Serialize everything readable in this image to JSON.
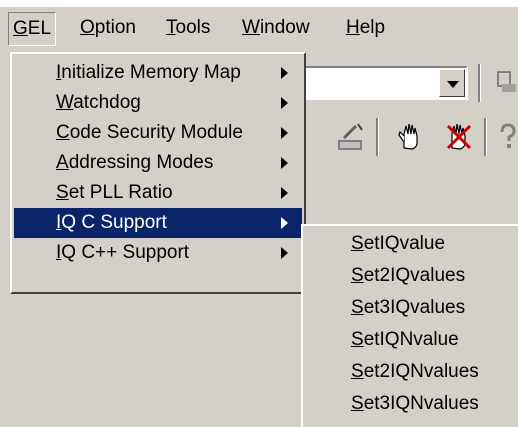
{
  "menubar": {
    "items": [
      {
        "label": "GEL",
        "accel": "G",
        "rest": "EL"
      },
      {
        "label": "Option",
        "accel": "O",
        "rest": "ption"
      },
      {
        "label": "Tools",
        "accel": "T",
        "rest": "ools"
      },
      {
        "label": "Window",
        "accel": "W",
        "rest": "indow"
      },
      {
        "label": "Help",
        "accel": "H",
        "rest": "elp"
      }
    ]
  },
  "gel_menu": {
    "items": [
      {
        "accel": "I",
        "rest": "nitialize Memory Map",
        "submenu": true
      },
      {
        "accel": "W",
        "rest": "atchdog",
        "submenu": true
      },
      {
        "accel": "C",
        "rest": "ode Security Module",
        "submenu": true
      },
      {
        "accel": "A",
        "rest": "ddressing Modes",
        "submenu": true
      },
      {
        "accel": "S",
        "rest": "et PLL Ratio",
        "submenu": true
      },
      {
        "accel": "I",
        "rest": "Q C Support",
        "submenu": true,
        "highlighted": true
      },
      {
        "accel": "I",
        "rest": "Q C++ Support",
        "submenu": true
      }
    ]
  },
  "iq_c_submenu": {
    "items": [
      {
        "accel": "S",
        "rest": "etIQvalue"
      },
      {
        "accel": "S",
        "rest": "et2IQvalues"
      },
      {
        "accel": "S",
        "rest": "et3IQvalues"
      },
      {
        "accel": "S",
        "rest": "etIQNvalue"
      },
      {
        "accel": "S",
        "rest": "et2IQNvalues"
      },
      {
        "accel": "S",
        "rest": "et3IQNvalues"
      }
    ]
  },
  "toolbar": {
    "icons": [
      "build-icon",
      "hand-icon",
      "breakpoint-icon",
      "help-icon"
    ]
  },
  "colors": {
    "face": "#d4d0c8",
    "highlight": "#0a246a",
    "highlight_text": "#ffffff"
  }
}
